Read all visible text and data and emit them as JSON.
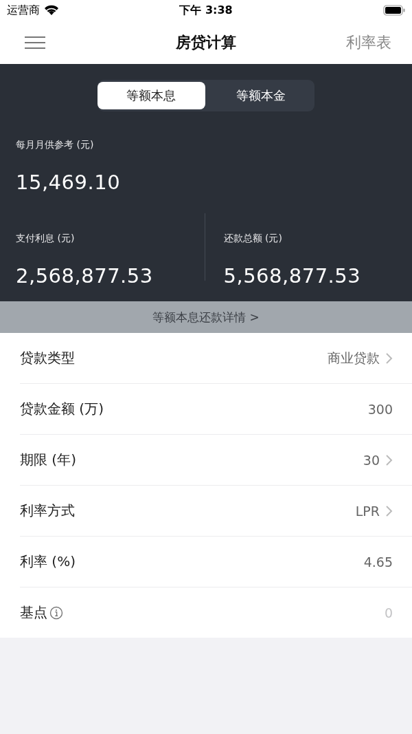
{
  "status_bar": {
    "carrier": "运营商",
    "time": "下午 3:38"
  },
  "nav": {
    "title": "房贷计算",
    "action": "利率表"
  },
  "segments": [
    {
      "label": "等额本息",
      "selected": true
    },
    {
      "label": "等额本金",
      "selected": false
    }
  ],
  "summary": {
    "monthly": {
      "label": "每月月供参考 (元)",
      "value": "15,469.10"
    },
    "stats": [
      {
        "label": "支付利息 (元)",
        "value": "2,568,877.53"
      },
      {
        "label": "还款总额 (元)",
        "value": "5,568,877.53"
      }
    ]
  },
  "detail_link": "等额本息还款详情 >",
  "rows": [
    {
      "kind": "picker",
      "label": "贷款类型",
      "value": "商业贷款",
      "info": false
    },
    {
      "kind": "input",
      "label": "贷款金额 (万)",
      "value": "300",
      "info": false
    },
    {
      "kind": "picker",
      "label": "期限 (年)",
      "value": "30",
      "info": false
    },
    {
      "kind": "picker",
      "label": "利率方式",
      "value": "LPR",
      "info": false
    },
    {
      "kind": "input",
      "label": "利率 (%)",
      "value": "4.65",
      "info": false
    },
    {
      "kind": "input",
      "label": "基点",
      "placeholder": "0",
      "info": true
    }
  ]
}
